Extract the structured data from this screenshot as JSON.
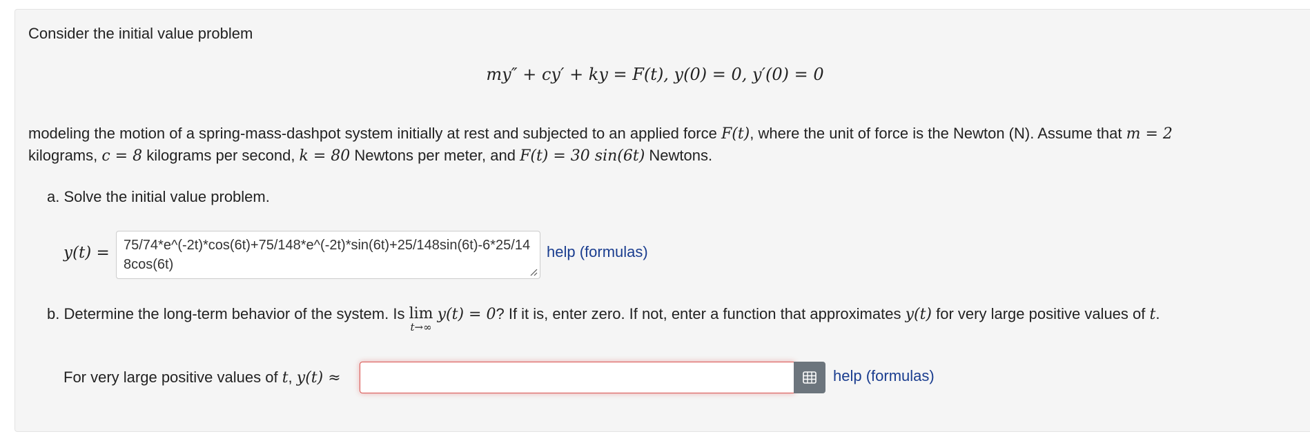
{
  "intro": "Consider the initial value problem",
  "equation": "my″ + cy′ + ky = F(t),   y(0) = 0,   y′(0) = 0",
  "desc": {
    "p1": "modeling the motion of a spring-mass-dashpot system initially at rest and subjected to an applied force ",
    "Ft": "F(t)",
    "p2": ", where the unit of force is the Newton (N). Assume that ",
    "m_eq": "m = 2",
    "p3": "kilograms, ",
    "c_eq": "c = 8",
    "p4": " kilograms per second, ",
    "k_eq": "k = 80",
    "p5": " Newtons per meter, and ",
    "F_eq": "F(t) = 30 sin(6t)",
    "p6": " Newtons."
  },
  "part_a": {
    "label": "a. Solve the initial value problem.",
    "lhs": "y(t) =",
    "answer": "75/74*e^(-2t)*cos(6t)+75/148*e^(-2t)*sin(6t)+25/148sin(6t)-6*25/148cos(6t)",
    "help": "help (formulas)"
  },
  "part_b": {
    "p1": "b. Determine the long-term behavior of the system. Is ",
    "lim": "lim",
    "lim_sub": "t→∞",
    "p2": "y(t) = 0",
    "p3": "? If it is, enter zero. If not, enter a function that approximates ",
    "yt": "y(t)",
    "p4": " for very large positive values of ",
    "t": "t",
    "p5": "."
  },
  "part_b_answer": {
    "label": "For very large positive values of ",
    "t": "t",
    "comma": ", ",
    "approx": "y(t) ≈",
    "value": "",
    "help": "help (formulas)"
  },
  "colors": {
    "accent": "#1a3d8f",
    "error": "#d9534f",
    "button": "#6c757d"
  },
  "icons": {
    "grid": "grid-icon"
  }
}
